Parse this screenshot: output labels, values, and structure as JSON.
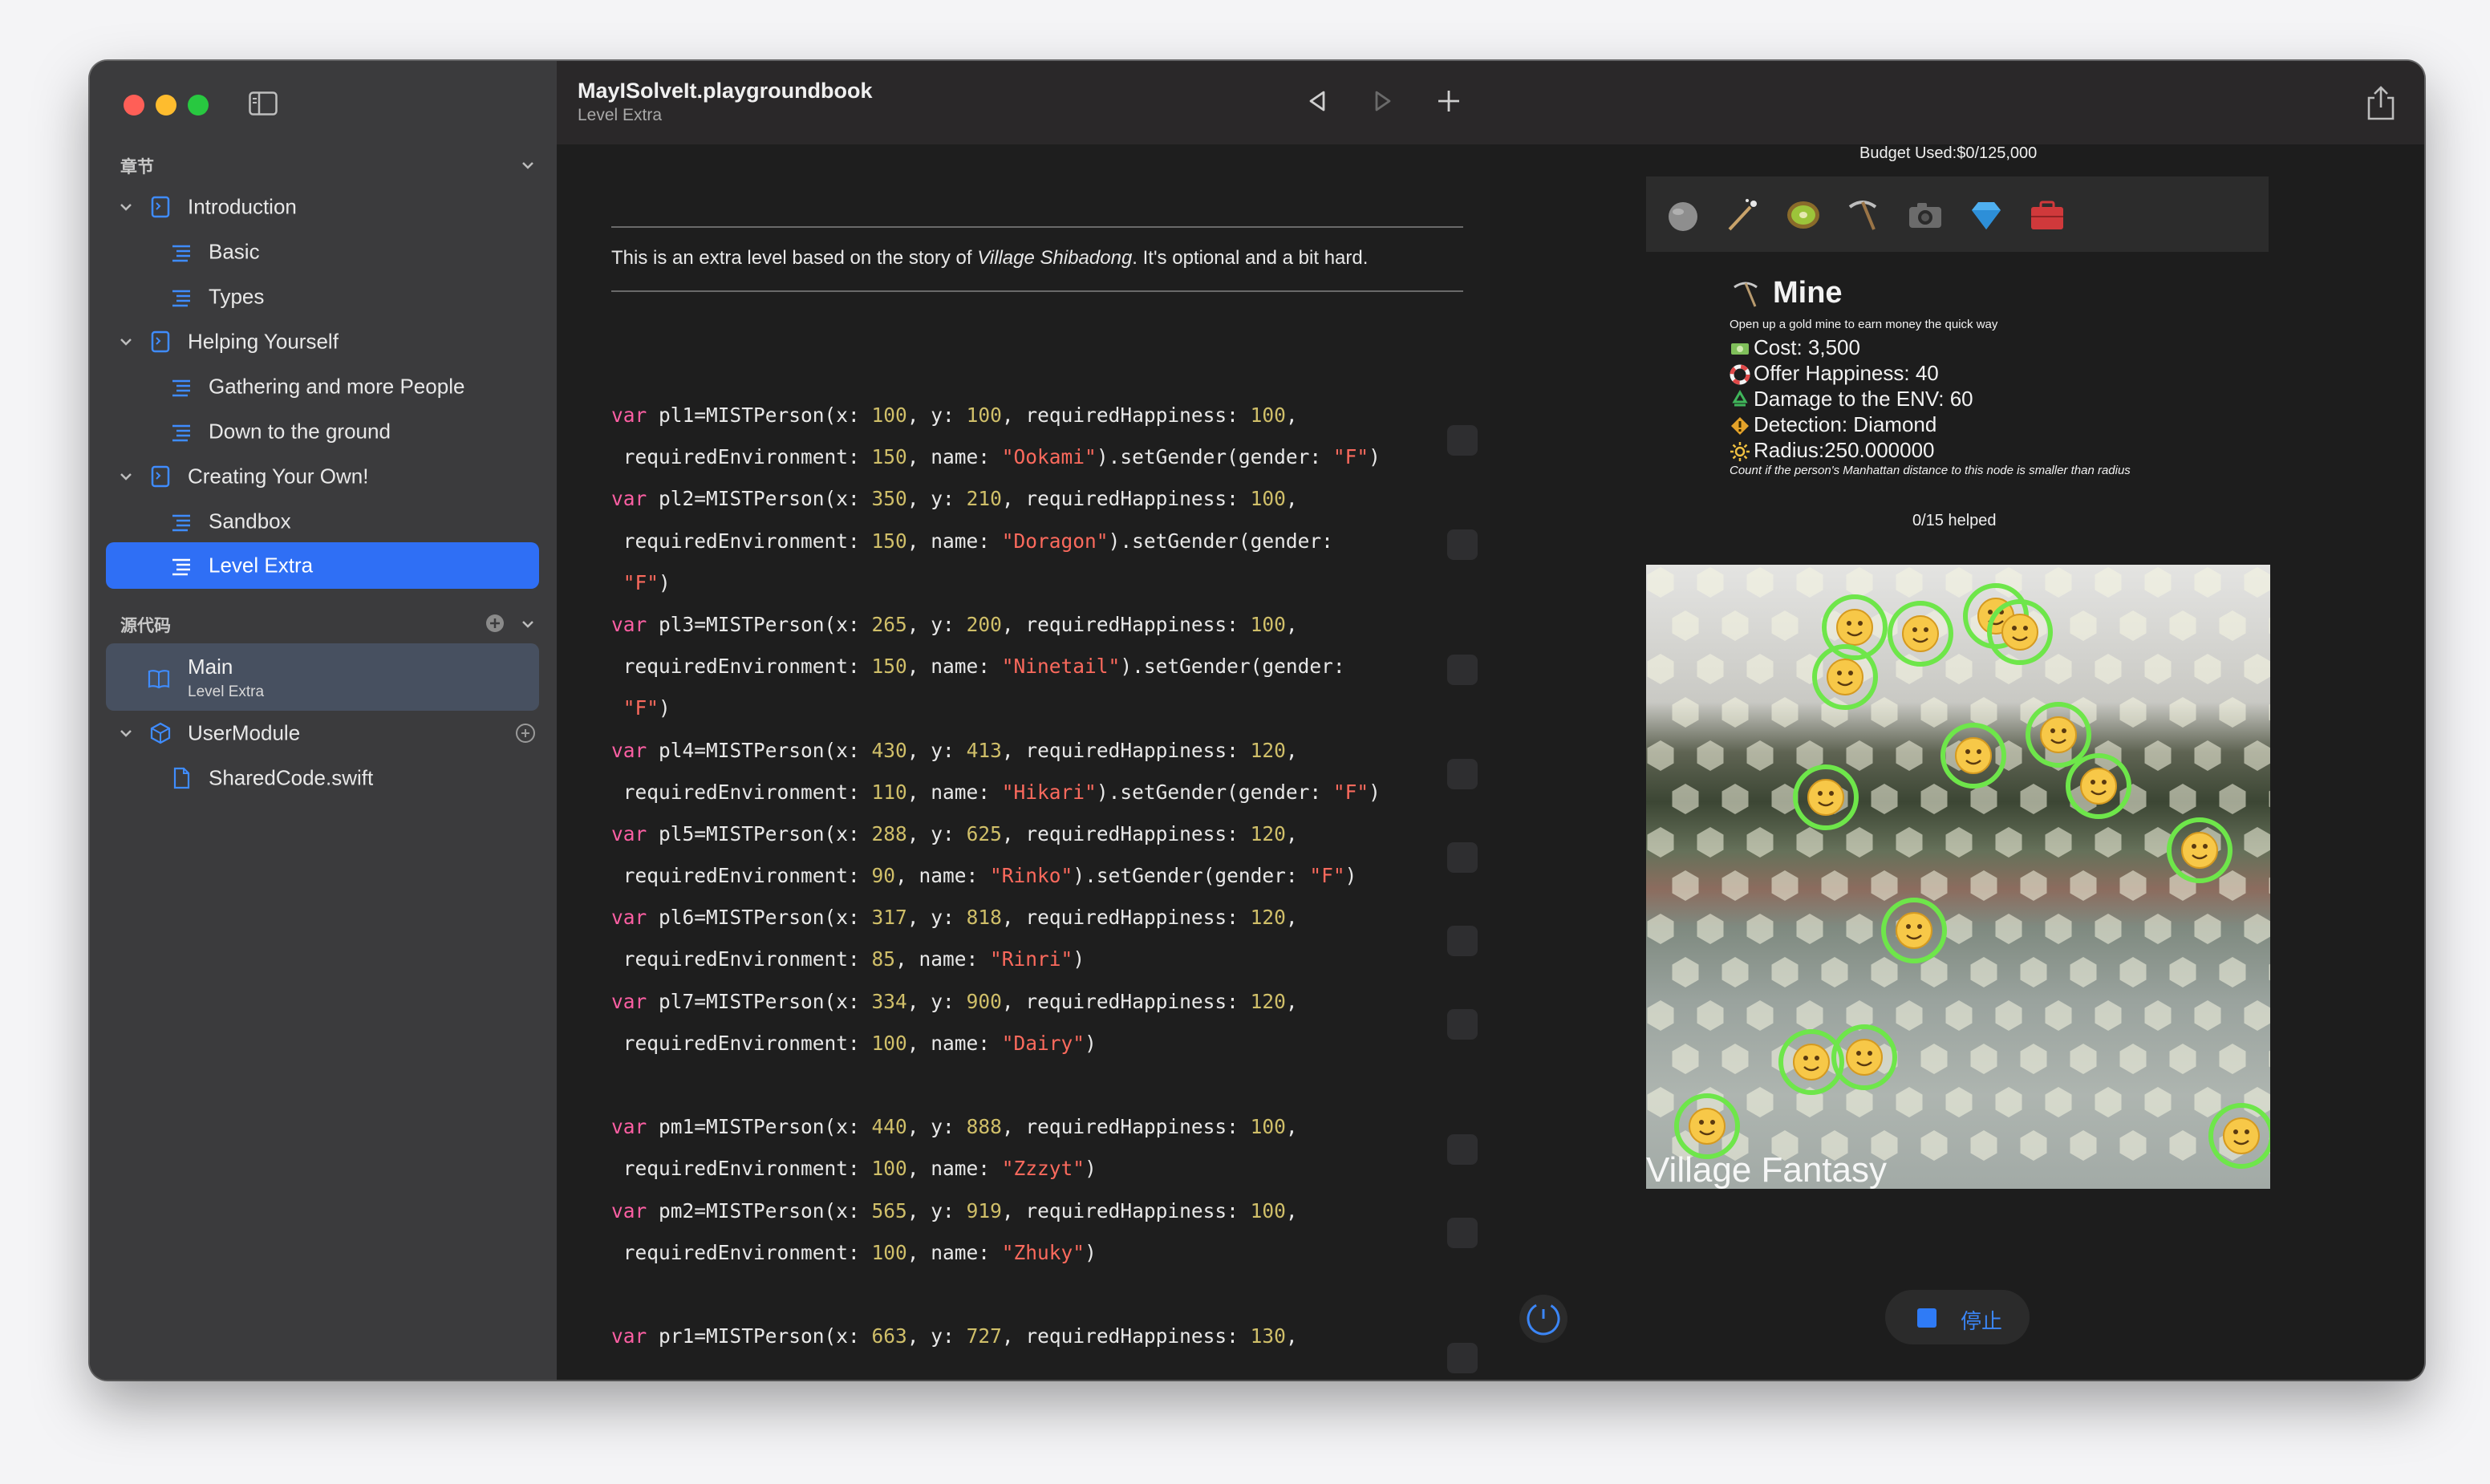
{
  "sidebar": {
    "chapters_label": "章节",
    "chapters": [
      {
        "label": "Introduction",
        "pages": [
          "Basic",
          "Types"
        ]
      },
      {
        "label": "Helping Yourself",
        "pages": [
          "Gathering and more People",
          "Down to the ground"
        ]
      },
      {
        "label": "Creating Your Own!",
        "pages": [
          "Sandbox",
          "Level Extra"
        ]
      }
    ],
    "sources_label": "源代码",
    "main_label": "Main",
    "main_sub": "Level Extra",
    "module_label": "UserModule",
    "file_label": "SharedCode.swift"
  },
  "editor": {
    "title": "MayISolveIt.playgroundbook",
    "subtitle": "Level Extra",
    "prose_before": "This is an extra level based on the story of ",
    "prose_italic": "Village Shibadong",
    "prose_after": ". It's optional and a bit hard.",
    "code_lines": [
      "var pl1=MISTPerson(x: 100, y: 100, requiredHappiness: 100,",
      " requiredEnvironment: 150, name: \"Ookami\").setGender(gender: \"F\")",
      "var pl2=MISTPerson(x: 350, y: 210, requiredHappiness: 100,",
      " requiredEnvironment: 150, name: \"Doragon\").setGender(gender:",
      " \"F\")",
      "var pl3=MISTPerson(x: 265, y: 200, requiredHappiness: 100,",
      " requiredEnvironment: 150, name: \"Ninetail\").setGender(gender:",
      " \"F\")",
      "var pl4=MISTPerson(x: 430, y: 413, requiredHappiness: 120,",
      " requiredEnvironment: 110, name: \"Hikari\").setGender(gender: \"F\")",
      "var pl5=MISTPerson(x: 288, y: 625, requiredHappiness: 120,",
      " requiredEnvironment: 90, name: \"Rinko\").setGender(gender: \"F\")",
      "var pl6=MISTPerson(x: 317, y: 818, requiredHappiness: 120,",
      " requiredEnvironment: 85, name: \"Rinri\")",
      "var pl7=MISTPerson(x: 334, y: 900, requiredHappiness: 120,",
      " requiredEnvironment: 100, name: \"Dairy\")",
      "",
      "var pm1=MISTPerson(x: 440, y: 888, requiredHappiness: 100,",
      " requiredEnvironment: 100, name: \"Zzzyt\")",
      "var pm2=MISTPerson(x: 565, y: 919, requiredHappiness: 100,",
      " requiredEnvironment: 100, name: \"Zhuky\")",
      "",
      "var pr1=MISTPerson(x: 663, y: 727, requiredHappiness: 130,"
    ]
  },
  "liveview": {
    "budget": "Budget Used:$0/125,000",
    "palette_icons": [
      "stone-icon",
      "wand-icon",
      "kiwi-icon",
      "pickaxe-icon",
      "camera-icon",
      "diamond-icon",
      "toolbox-icon"
    ],
    "info": {
      "title": "Mine",
      "description": "Open up a gold mine to earn money the quick way",
      "cost": "Cost: 3,500",
      "happiness": "Offer Happiness: 40",
      "damage": "Damage to the ENV: 60",
      "detection": "Detection: Diamond",
      "radius": "Radius:250.000000",
      "note": "Count if the person's Manhattan distance to this node is smaller than radius"
    },
    "helped": "0/15 helped",
    "game_title": "Village Fantasy",
    "stop_label": "停止",
    "ring_color": "#6ee64a",
    "accent_color": "#2f7bf6"
  }
}
